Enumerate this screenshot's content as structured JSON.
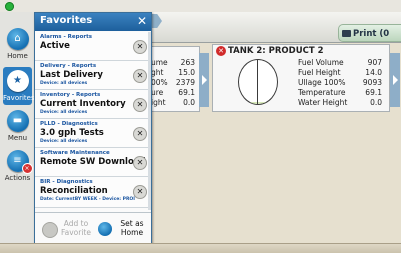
{
  "header": {
    "print_label": "Print (0"
  },
  "rail": {
    "items": [
      {
        "label": "Home",
        "icon": "home-icon"
      },
      {
        "label": "Favorites",
        "icon": "star-icon"
      },
      {
        "label": "Menu",
        "icon": "menu-icon"
      },
      {
        "label": "Actions",
        "icon": "actions-icon"
      }
    ]
  },
  "tank1_partial": {
    "rows": [
      {
        "label": "ume",
        "value": "263"
      },
      {
        "label": "ght",
        "value": "15.0"
      },
      {
        "label": "00%",
        "value": "2379"
      },
      {
        "label": "ure",
        "value": "69.1"
      },
      {
        "label": "ight",
        "value": "0.0"
      }
    ]
  },
  "tank2": {
    "title": "TANK 2: PRODUCT 2",
    "fill_fraction": 0.05,
    "rows": [
      {
        "label": "Fuel Volume",
        "value": "907"
      },
      {
        "label": "Fuel Height",
        "value": "14.0"
      },
      {
        "label": "Ullage 100%",
        "value": "9093"
      },
      {
        "label": "Temperature",
        "value": "69.1"
      },
      {
        "label": "Water Height",
        "value": "0.0"
      }
    ]
  },
  "favorites": {
    "title": "Favorites",
    "items": [
      {
        "category": "Alarms - Reports",
        "name": "Active",
        "sub": ""
      },
      {
        "category": "Delivery - Reports",
        "name": "Last Delivery",
        "sub": "Device: all devices"
      },
      {
        "category": "Inventory - Reports",
        "name": "Current Inventory",
        "sub": "Device: all devices"
      },
      {
        "category": "PLLD - Diagnostics",
        "name": "3.0 gph Tests",
        "sub": "Device: all devices"
      },
      {
        "category": "Software Maintenance",
        "name": "Remote SW Download",
        "sub": ""
      },
      {
        "category": "BIR - Diagnostics",
        "name": "Reconciliation",
        "sub": "Date: CurrentBY WEEK - Device: PROI"
      }
    ],
    "add_label": "Add to Favorite",
    "home_label": "Set as Home"
  }
}
